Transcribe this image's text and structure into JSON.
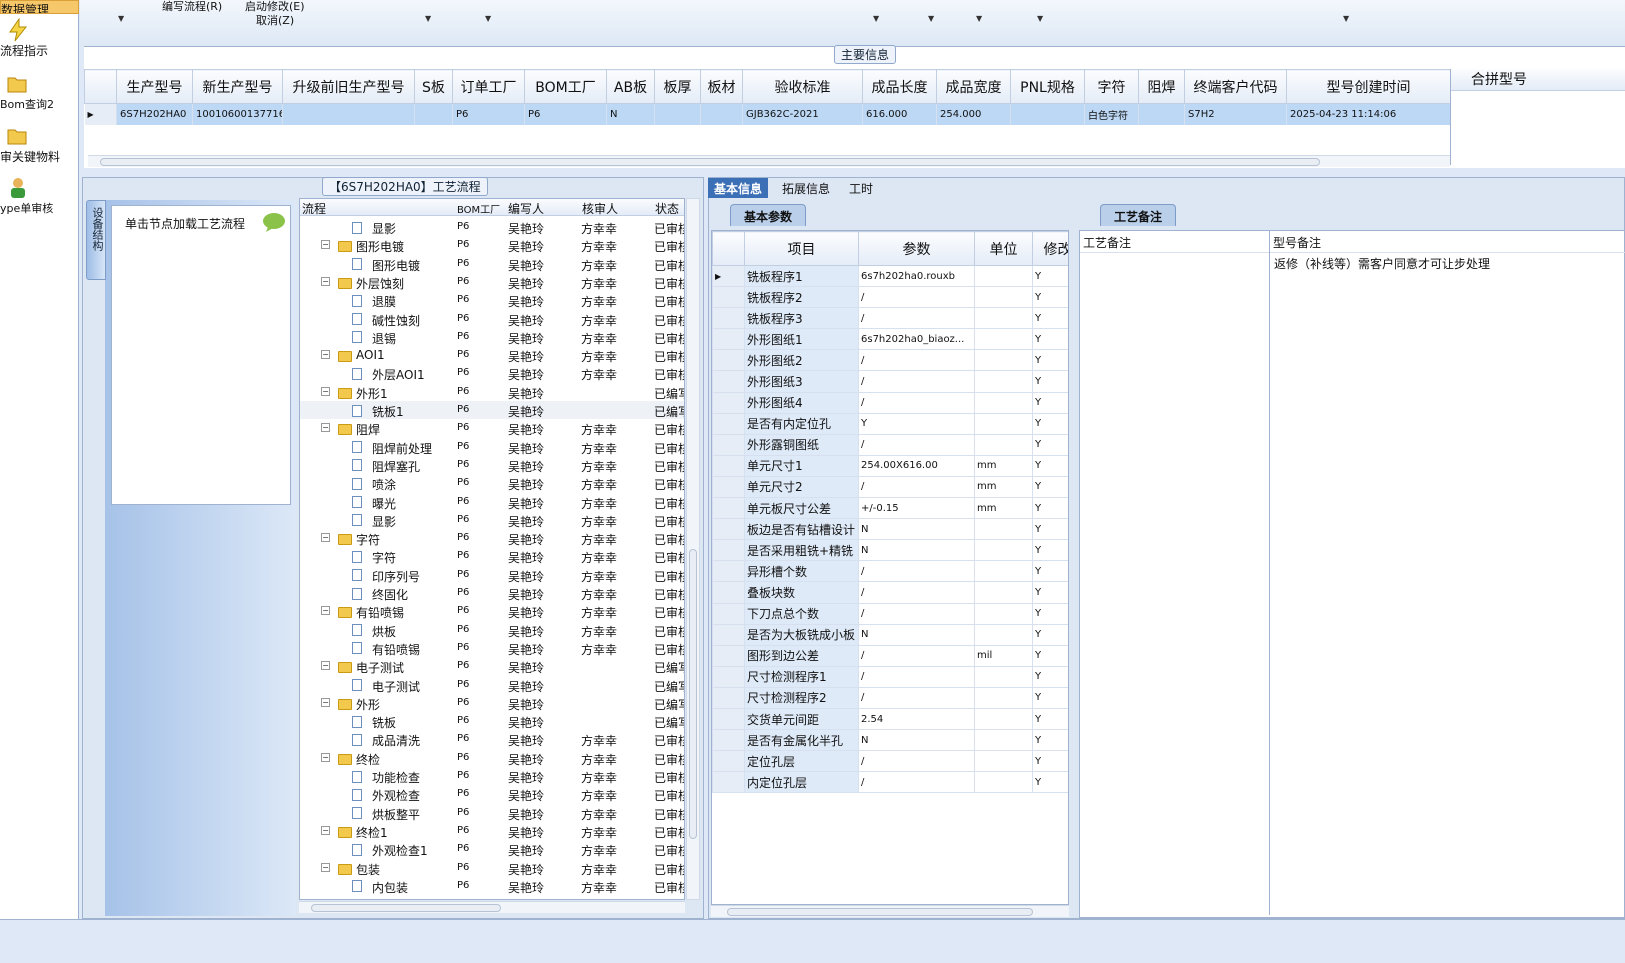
{
  "left_nav": {
    "top_item": "数据管理",
    "items": [
      "流程指示",
      "Bom查询2",
      "审关键物料",
      "ype单审核"
    ]
  },
  "menu": {
    "edit_flow": "编写流程(R)",
    "start_modify": "启动修改(E)",
    "cancel": "取消(Z)"
  },
  "main_info": {
    "title": "主要信息",
    "merge_label": "合拼型号",
    "columns": [
      "生产型号",
      "新生产型号",
      "升级前旧生产型号",
      "S板",
      "订单工厂",
      "BOM工厂",
      "AB板",
      "板厚",
      "板材",
      "验收标准",
      "成品长度",
      "成品宽度",
      "PNL规格",
      "字符",
      "阻焊",
      "终端客户代码",
      "型号创建时间"
    ],
    "row": [
      "6S7H202HA0",
      "10010600137716",
      "",
      "",
      "P6",
      "P6",
      "N",
      "",
      "",
      "GJB362C-2021",
      "616.000",
      "254.000",
      "",
      "白色字符",
      "",
      "S7H2",
      "2025-04-23 11:14:06"
    ]
  },
  "flow": {
    "title": "【6S7H202HA0】工艺流程",
    "side_tab": "设备结构",
    "hint": "单击节点加载工艺流程",
    "columns": [
      "流程",
      "BOM工厂",
      "编写人",
      "核审人",
      "状态"
    ],
    "rows": [
      {
        "name": "显影",
        "l": 2,
        "b": "P6",
        "w": "吴艳玲",
        "r": "方幸幸",
        "s": "已审核"
      },
      {
        "name": "图形电镀",
        "l": 1,
        "b": "P6",
        "w": "吴艳玲",
        "r": "方幸幸",
        "s": "已审核"
      },
      {
        "name": "图形电镀",
        "l": 2,
        "b": "P6",
        "w": "吴艳玲",
        "r": "方幸幸",
        "s": "已审核"
      },
      {
        "name": "外层蚀刻",
        "l": 1,
        "b": "P6",
        "w": "吴艳玲",
        "r": "方幸幸",
        "s": "已审核"
      },
      {
        "name": "退膜",
        "l": 2,
        "b": "P6",
        "w": "吴艳玲",
        "r": "方幸幸",
        "s": "已审核"
      },
      {
        "name": "碱性蚀刻",
        "l": 2,
        "b": "P6",
        "w": "吴艳玲",
        "r": "方幸幸",
        "s": "已审核"
      },
      {
        "name": "退锡",
        "l": 2,
        "b": "P6",
        "w": "吴艳玲",
        "r": "方幸幸",
        "s": "已审核"
      },
      {
        "name": "AOI1",
        "l": 1,
        "b": "P6",
        "w": "吴艳玲",
        "r": "方幸幸",
        "s": "已审核"
      },
      {
        "name": "外层AOI1",
        "l": 2,
        "b": "P6",
        "w": "吴艳玲",
        "r": "方幸幸",
        "s": "已审核"
      },
      {
        "name": "外形1",
        "l": 1,
        "b": "P6",
        "w": "吴艳玲",
        "r": "",
        "s": "已编写"
      },
      {
        "name": "铣板1",
        "l": 2,
        "b": "P6",
        "w": "吴艳玲",
        "r": "",
        "s": "已编写"
      },
      {
        "name": "阻焊",
        "l": 1,
        "b": "P6",
        "w": "吴艳玲",
        "r": "方幸幸",
        "s": "已审核"
      },
      {
        "name": "阻焊前处理",
        "l": 2,
        "b": "P6",
        "w": "吴艳玲",
        "r": "方幸幸",
        "s": "已审核"
      },
      {
        "name": "阻焊塞孔",
        "l": 2,
        "b": "P6",
        "w": "吴艳玲",
        "r": "方幸幸",
        "s": "已审核"
      },
      {
        "name": "喷涂",
        "l": 2,
        "b": "P6",
        "w": "吴艳玲",
        "r": "方幸幸",
        "s": "已审核"
      },
      {
        "name": "曝光",
        "l": 2,
        "b": "P6",
        "w": "吴艳玲",
        "r": "方幸幸",
        "s": "已审核"
      },
      {
        "name": "显影",
        "l": 2,
        "b": "P6",
        "w": "吴艳玲",
        "r": "方幸幸",
        "s": "已审核"
      },
      {
        "name": "字符",
        "l": 1,
        "b": "P6",
        "w": "吴艳玲",
        "r": "方幸幸",
        "s": "已审核"
      },
      {
        "name": "字符",
        "l": 2,
        "b": "P6",
        "w": "吴艳玲",
        "r": "方幸幸",
        "s": "已审核"
      },
      {
        "name": "印序列号",
        "l": 2,
        "b": "P6",
        "w": "吴艳玲",
        "r": "方幸幸",
        "s": "已审核"
      },
      {
        "name": "终固化",
        "l": 2,
        "b": "P6",
        "w": "吴艳玲",
        "r": "方幸幸",
        "s": "已审核"
      },
      {
        "name": "有铅喷锡",
        "l": 1,
        "b": "P6",
        "w": "吴艳玲",
        "r": "方幸幸",
        "s": "已审核"
      },
      {
        "name": "烘板",
        "l": 2,
        "b": "P6",
        "w": "吴艳玲",
        "r": "方幸幸",
        "s": "已审核"
      },
      {
        "name": "有铅喷锡",
        "l": 2,
        "b": "P6",
        "w": "吴艳玲",
        "r": "方幸幸",
        "s": "已审核"
      },
      {
        "name": "电子测试",
        "l": 1,
        "b": "P6",
        "w": "吴艳玲",
        "r": "",
        "s": "已编写"
      },
      {
        "name": "电子测试",
        "l": 2,
        "b": "P6",
        "w": "吴艳玲",
        "r": "",
        "s": "已编写"
      },
      {
        "name": "外形",
        "l": 1,
        "b": "P6",
        "w": "吴艳玲",
        "r": "",
        "s": "已编写"
      },
      {
        "name": "铣板",
        "l": 2,
        "b": "P6",
        "w": "吴艳玲",
        "r": "",
        "s": "已编写"
      },
      {
        "name": "成品清洗",
        "l": 2,
        "b": "P6",
        "w": "吴艳玲",
        "r": "方幸幸",
        "s": "已审核"
      },
      {
        "name": "终检",
        "l": 1,
        "b": "P6",
        "w": "吴艳玲",
        "r": "方幸幸",
        "s": "已审核"
      },
      {
        "name": "功能检查",
        "l": 2,
        "b": "P6",
        "w": "吴艳玲",
        "r": "方幸幸",
        "s": "已审核"
      },
      {
        "name": "外观检查",
        "l": 2,
        "b": "P6",
        "w": "吴艳玲",
        "r": "方幸幸",
        "s": "已审核"
      },
      {
        "name": "烘板整平",
        "l": 2,
        "b": "P6",
        "w": "吴艳玲",
        "r": "方幸幸",
        "s": "已审核"
      },
      {
        "name": "终检1",
        "l": 1,
        "b": "P6",
        "w": "吴艳玲",
        "r": "方幸幸",
        "s": "已审核"
      },
      {
        "name": "外观检查1",
        "l": 2,
        "b": "P6",
        "w": "吴艳玲",
        "r": "方幸幸",
        "s": "已审核"
      },
      {
        "name": "包装",
        "l": 1,
        "b": "P6",
        "w": "吴艳玲",
        "r": "方幸幸",
        "s": "已审核"
      },
      {
        "name": "内包装",
        "l": 2,
        "b": "P6",
        "w": "吴艳玲",
        "r": "方幸幸",
        "s": "已审核"
      }
    ]
  },
  "right": {
    "tabs": [
      "基本信息",
      "拓展信息",
      "工时"
    ],
    "sub_tab": "基本参数",
    "note_tab": "工艺备注",
    "param_columns": [
      "项目",
      "参数",
      "单位",
      "修改"
    ],
    "params": [
      [
        "铣板程序1",
        "6s7h202ha0.rouxb",
        "",
        "Y"
      ],
      [
        "铣板程序2",
        "/",
        "",
        "Y"
      ],
      [
        "铣板程序3",
        "/",
        "",
        "Y"
      ],
      [
        "外形图纸1",
        "6s7h202ha0_biaoz...",
        "",
        "Y"
      ],
      [
        "外形图纸2",
        "/",
        "",
        "Y"
      ],
      [
        "外形图纸3",
        "/",
        "",
        "Y"
      ],
      [
        "外形图纸4",
        "/",
        "",
        "Y"
      ],
      [
        "是否有内定位孔",
        "Y",
        "",
        "Y"
      ],
      [
        "外形露铜图纸",
        "/",
        "",
        "Y"
      ],
      [
        "单元尺寸1",
        "254.00X616.00",
        "mm",
        "Y"
      ],
      [
        "单元尺寸2",
        "/",
        "mm",
        "Y"
      ],
      [
        "单元板尺寸公差",
        "+/-0.15",
        "mm",
        "Y"
      ],
      [
        "板边是否有钻槽设计",
        "N",
        "",
        "Y"
      ],
      [
        "是否采用粗铣+精铣",
        "N",
        "",
        "Y"
      ],
      [
        "异形槽个数",
        "/",
        "",
        "Y"
      ],
      [
        "叠板块数",
        "/",
        "",
        "Y"
      ],
      [
        "下刀点总个数",
        "/",
        "",
        "Y"
      ],
      [
        "是否为大板铣成小板",
        "N",
        "",
        "Y"
      ],
      [
        "图形到边公差",
        "/",
        "mil",
        "Y"
      ],
      [
        "尺寸检测程序1",
        "/",
        "",
        "Y"
      ],
      [
        "尺寸检测程序2",
        "/",
        "",
        "Y"
      ],
      [
        "交货单元间距",
        "2.54",
        "",
        "Y"
      ],
      [
        "是否有金属化半孔",
        "N",
        "",
        "Y"
      ],
      [
        "定位孔层",
        "/",
        "",
        "Y"
      ],
      [
        "内定位孔层",
        "/",
        "",
        "Y"
      ]
    ],
    "note_col1": "工艺备注",
    "note_col2": "型号备注",
    "model_note": "返修（补线等）需客户同意才可让步处理"
  },
  "colors": {
    "accent": "#bdd8f5",
    "panel": "#dde6f3"
  }
}
